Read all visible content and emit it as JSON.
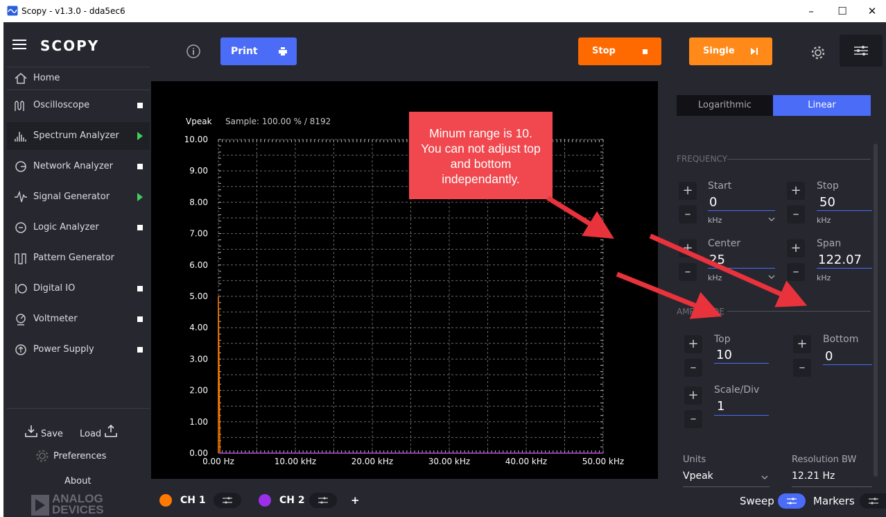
{
  "window": {
    "title": "Scopy - v1.3.0 - dda5ec6"
  },
  "logo": "SCOPY",
  "nav": [
    {
      "label": "Home",
      "icon": "home-icon"
    },
    {
      "label": "Oscilloscope",
      "icon": "oscilloscope-icon",
      "state": "stopped"
    },
    {
      "label": "Spectrum Analyzer",
      "icon": "spectrum-icon",
      "state": "running"
    },
    {
      "label": "Network Analyzer",
      "icon": "network-icon",
      "state": "stopped"
    },
    {
      "label": "Signal Generator",
      "icon": "signal-icon",
      "state": "running"
    },
    {
      "label": "Logic Analyzer",
      "icon": "logic-icon",
      "state": "stopped"
    },
    {
      "label": "Pattern Generator",
      "icon": "pattern-icon",
      "state": "none"
    },
    {
      "label": "Digital IO",
      "icon": "digital-io-icon",
      "state": "stopped"
    },
    {
      "label": "Voltmeter",
      "icon": "voltmeter-icon",
      "state": "stopped"
    },
    {
      "label": "Power Supply",
      "icon": "power-icon",
      "state": "stopped"
    }
  ],
  "sidebar_footer": {
    "save": "Save",
    "load": "Load",
    "preferences": "Preferences",
    "about": "About",
    "brand": "ANALOG DEVICES"
  },
  "toolbar": {
    "print": "Print",
    "stop": "Stop",
    "single": "Single"
  },
  "plot": {
    "ylabel": "Vpeak",
    "sample": "Sample: 100.00 % / 8192"
  },
  "callout": [
    "Minum range is 10.",
    "You can not adjust top",
    "and bottom",
    "independantly."
  ],
  "scale": {
    "log": "Logarithmic",
    "linear": "Linear"
  },
  "frequency": {
    "section": "FREQUENCY",
    "start_label": "Start",
    "start": "0",
    "start_unit": "kHz",
    "stop_label": "Stop",
    "stop": "50",
    "stop_unit": "kHz",
    "center_label": "Center",
    "center": "25",
    "center_unit": "kHz",
    "span_label": "Span",
    "span": "122.07",
    "span_unit": "kHz"
  },
  "amplitude": {
    "section": "AMPLITUDE",
    "top_label": "Top",
    "top": "10",
    "bottom_label": "Bottom",
    "bottom": "0",
    "scale_label": "Scale/Div",
    "scale": "1"
  },
  "units": {
    "label": "Units",
    "value": "Vpeak"
  },
  "resbw": {
    "label": "Resolution BW",
    "value": "12.21 Hz"
  },
  "bottom": {
    "ch1": "CH 1",
    "ch2": "CH 2",
    "add": "+",
    "sweep": "Sweep",
    "markers": "Markers"
  },
  "colors": {
    "accent": "#4a6cf7",
    "stop": "#ff6a00",
    "single": "#ff8a1a",
    "ch1": "#ff7a00",
    "ch2": "#9b30e8",
    "callout": "#f0484e",
    "arrow": "#e8323c"
  },
  "chart_data": {
    "type": "line",
    "ylabel": "Vpeak",
    "xlim": [
      0,
      50
    ],
    "ylim": [
      0,
      10
    ],
    "xticks": [
      "0.00 Hz",
      "10.00 kHz",
      "20.00 kHz",
      "30.00 kHz",
      "40.00 kHz",
      "50.00 kHz"
    ],
    "yticks": [
      "0.00",
      "1.00",
      "2.00",
      "3.00",
      "4.00",
      "5.00",
      "6.00",
      "7.00",
      "8.00",
      "9.00",
      "10.00"
    ],
    "grid": true,
    "series": [
      {
        "x": [
          0.0,
          0.0,
          0.2,
          50
        ],
        "y": [
          0,
          5.0,
          0,
          0
        ]
      }
    ]
  }
}
